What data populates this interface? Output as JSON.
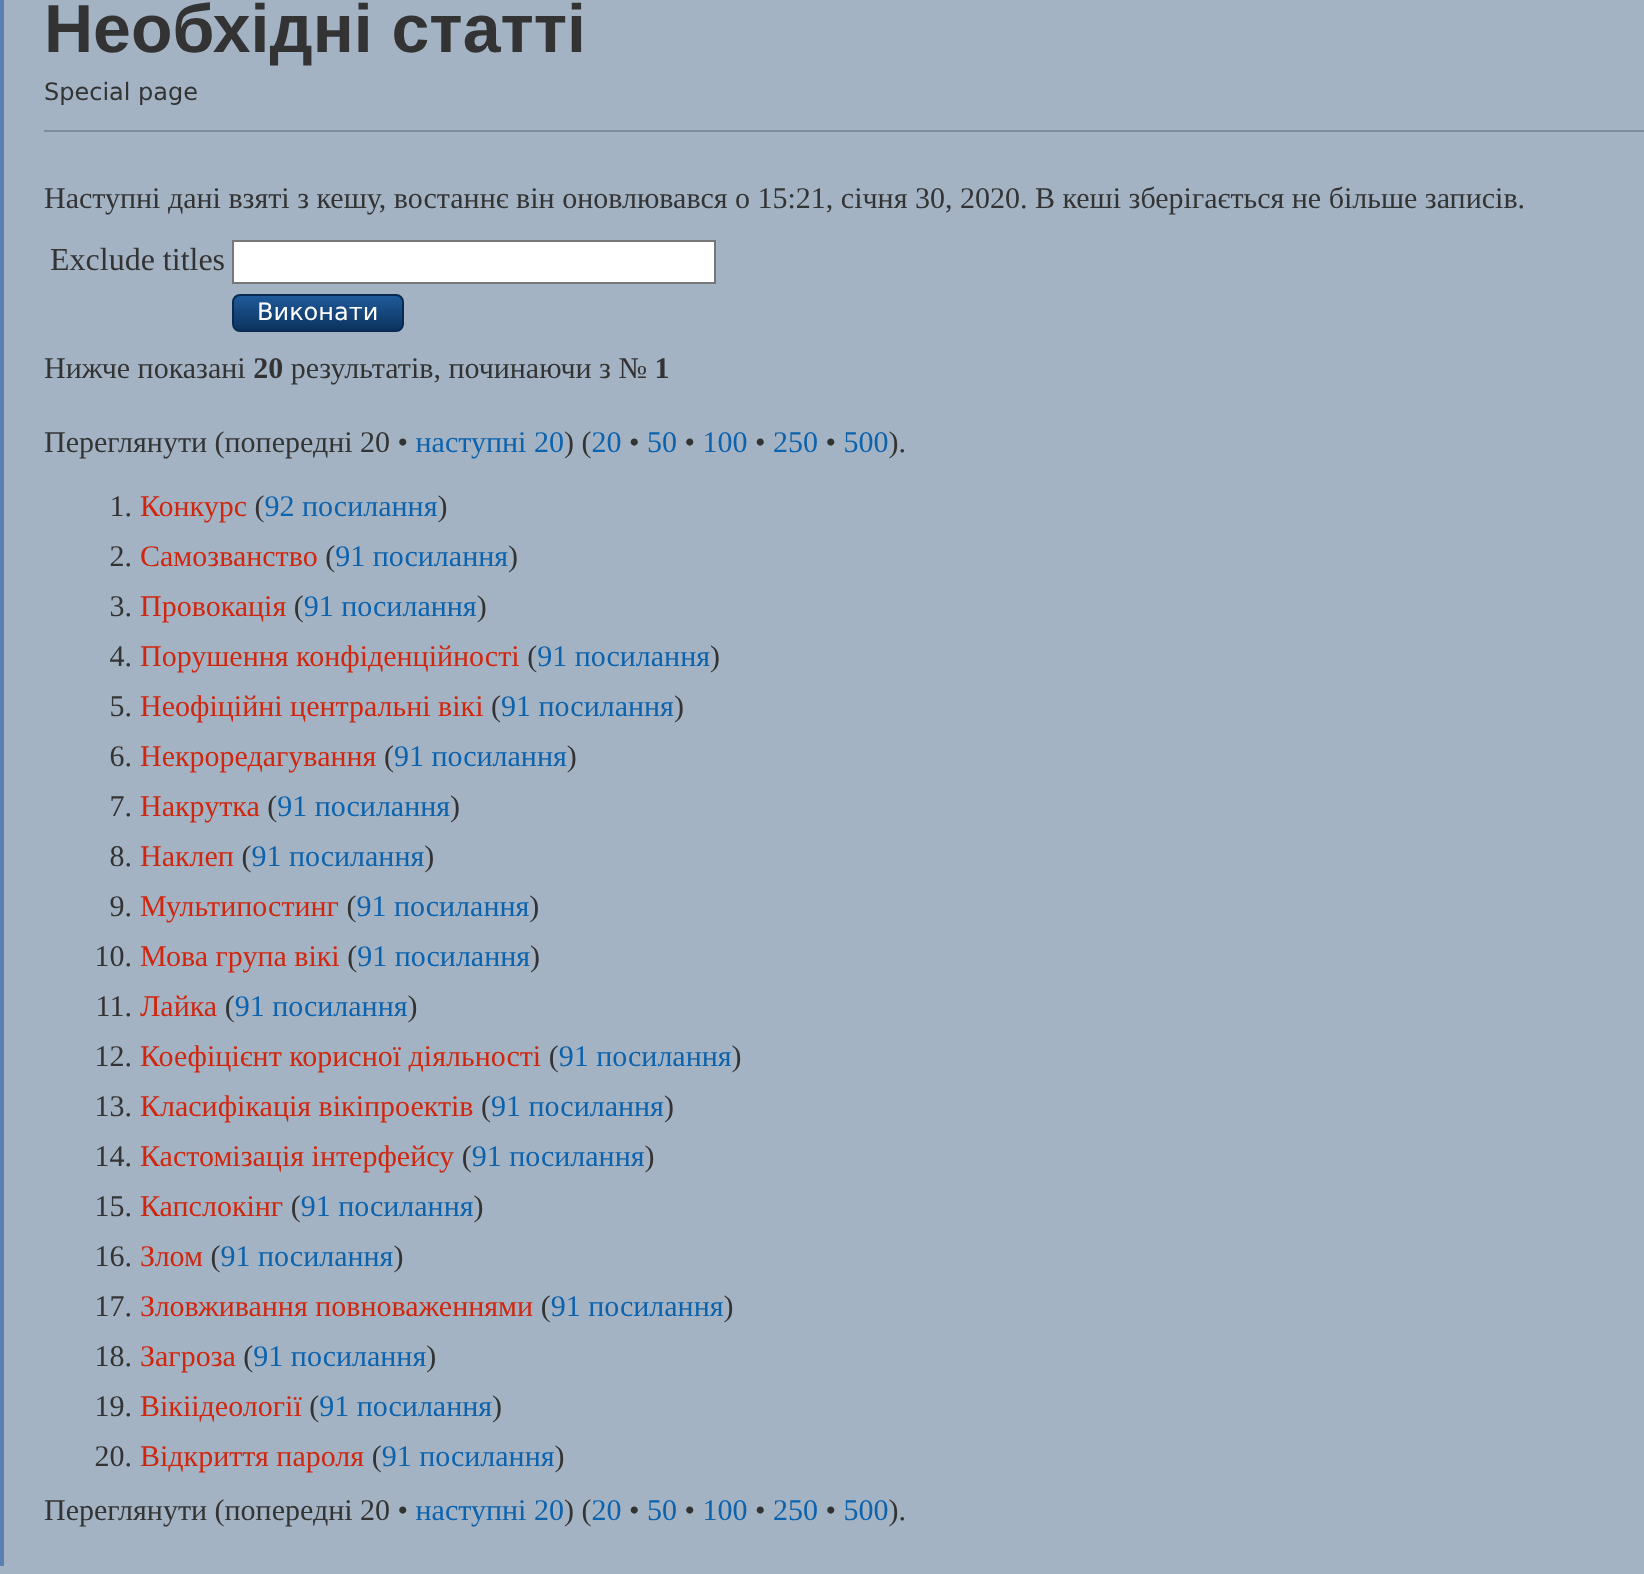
{
  "heading": {
    "title": "Необхідні статті",
    "subtitle": "Special page"
  },
  "cache_notice": "Наступні дані взяті з кешу, востаннє він оновлювався о 15:21, січня 30, 2020. В кеші зберігається не більше записів.",
  "form": {
    "label": "Exclude titles",
    "button": "Виконати"
  },
  "results_notice": "Нижче показані **20** результатів, починаючи з № **1**",
  "pagination_top": {
    "before": "Переглянути (попередні 20 • ",
    "next": "наступні 20",
    "middle": ") (",
    "limits": [
      "20",
      "50",
      "100",
      "250",
      "500"
    ],
    "separator": " • ",
    "after": ")."
  },
  "items": [
    {
      "number": "1.",
      "title": "Конкурс",
      "open": "(",
      "count": "92 посилання",
      "close": ")"
    },
    {
      "number": "2.",
      "title": "Самозванство",
      "open": "(",
      "count": "91 посилання",
      "close": ")"
    },
    {
      "number": "3.",
      "title": "Провокація",
      "open": "(",
      "count": "91 посилання",
      "close": ")"
    },
    {
      "number": "4.",
      "title": "Порушення конфіденційності",
      "open": "(",
      "count": "91 посилання",
      "close": ")"
    },
    {
      "number": "5.",
      "title": "Неофіційні центральні вікі",
      "open": "(",
      "count": "91 посилання",
      "close": ")"
    },
    {
      "number": "6.",
      "title": "Некроредагування",
      "open": "(",
      "count": "91 посилання",
      "close": ")"
    },
    {
      "number": "7.",
      "title": "Накрутка",
      "open": "(",
      "count": "91 посилання",
      "close": ")"
    },
    {
      "number": "8.",
      "title": "Наклеп",
      "open": "(",
      "count": "91 посилання",
      "close": ")"
    },
    {
      "number": "9.",
      "title": "Мультипостинг",
      "open": "(",
      "count": "91 посилання",
      "close": ")"
    },
    {
      "number": "10.",
      "title": "Мова група вікі",
      "open": "(",
      "count": "91 посилання",
      "close": ")"
    },
    {
      "number": "11.",
      "title": "Лайка",
      "open": "(",
      "count": "91 посилання",
      "close": ")"
    },
    {
      "number": "12.",
      "title": "Коефіцієнт корисної діяльності",
      "open": "(",
      "count": "91 посилання",
      "close": ")"
    },
    {
      "number": "13.",
      "title": "Класифікація вікіпроектів",
      "open": "(",
      "count": "91 посилання",
      "close": ")"
    },
    {
      "number": "14.",
      "title": "Кастомізація інтерфейсу",
      "open": "(",
      "count": "91 посилання",
      "close": ")"
    },
    {
      "number": "15.",
      "title": "Капслокінг",
      "open": "(",
      "count": "91 посилання",
      "close": ")"
    },
    {
      "number": "16.",
      "title": "Злом",
      "open": "(",
      "count": "91 посилання",
      "close": ")"
    },
    {
      "number": "17.",
      "title": "Зловживання повноваженнями",
      "open": "(",
      "count": "91 посилання",
      "close": ")"
    },
    {
      "number": "18.",
      "title": "Загроза",
      "open": "(",
      "count": "91 посилання",
      "close": ")"
    },
    {
      "number": "19.",
      "title": "Вікіідеології",
      "open": "(",
      "count": "91 посилання",
      "close": ")"
    },
    {
      "number": "20.",
      "title": "Відкриття пароля",
      "open": "(",
      "count": "91 посилання",
      "close": ")"
    }
  ],
  "pagination_bottom": {
    "before": "Переглянути (попередні 20 • ",
    "next": "наступні 20",
    "middle": ") (",
    "limits": [
      "20",
      "50",
      "100",
      "250",
      "500"
    ],
    "separator": " • ",
    "after": ")."
  }
}
